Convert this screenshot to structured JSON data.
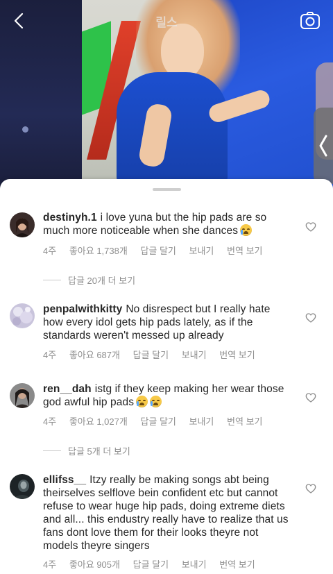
{
  "header": {
    "title": "릴스"
  },
  "icons": {
    "back": "chevron-left-icon",
    "camera": "camera-icon",
    "side_handle": "chevron-left-icon",
    "like": "heart-outline-icon",
    "emoji": "loudly-crying-face-emoji"
  },
  "colors": {
    "text": "#262626",
    "meta": "#8e8e8e",
    "sheet": "#ffffff"
  },
  "comments": [
    {
      "username": "destinyh.1",
      "text": "i love yuna but the hip pads are so much more noticeable when she dances",
      "emoji_count": 1,
      "time": "4주",
      "likes": "좋아요 1,738개",
      "reply": "답글 달기",
      "send": "보내기",
      "translate": "번역 보기",
      "view_replies": "답글 20개 더 보기"
    },
    {
      "username": "penpalwithkitty",
      "text": "No disrespect but I really hate how every idol gets hip pads lately, as if the standards weren't messed up already",
      "emoji_count": 0,
      "time": "4주",
      "likes": "좋아요 687개",
      "reply": "답글 달기",
      "send": "보내기",
      "translate": "번역 보기"
    },
    {
      "username": "ren__dah",
      "text": "istg if they keep making her wear those god awful hip pads",
      "emoji_count": 2,
      "time": "4주",
      "likes": "좋아요 1,027개",
      "reply": "답글 달기",
      "send": "보내기",
      "translate": "번역 보기",
      "view_replies": "답글 5개 더 보기"
    },
    {
      "username": "ellifss__",
      "text": "Itzy really be making songs abt being theirselves selflove bein confident etc but cannot refuse to wear huge hip pads, doing extreme diets and all... this endustry really have to realize that us fans dont love them for their looks theyre not models theyre singers",
      "emoji_count": 0,
      "time": "4주",
      "likes": "좋아요 905개",
      "reply": "답글 달기",
      "send": "보내기",
      "translate": "번역 보기"
    }
  ]
}
